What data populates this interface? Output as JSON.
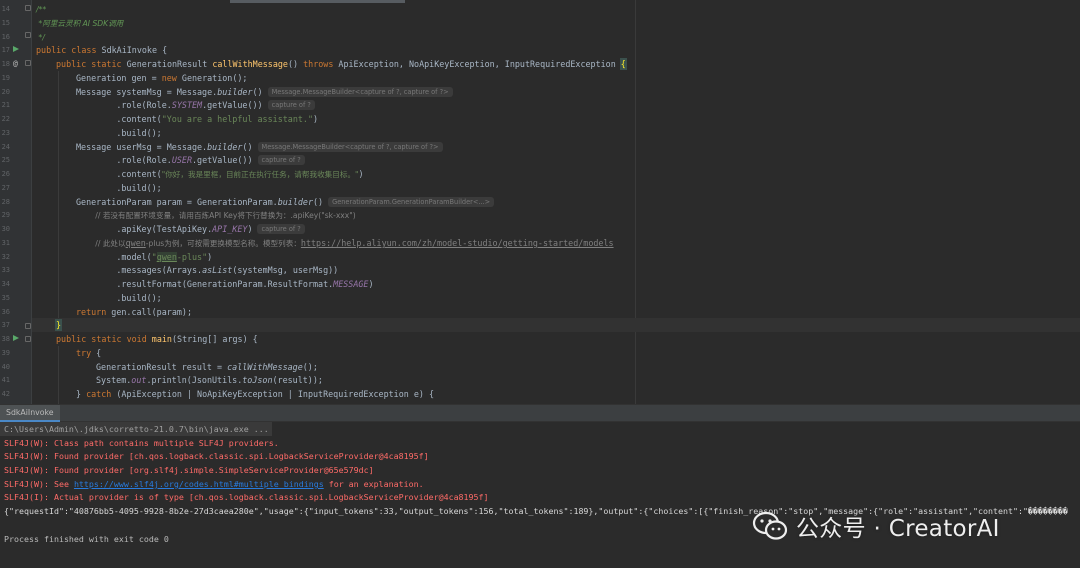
{
  "gutter": {
    "line_numbers": [
      "14",
      "15",
      "16",
      "17",
      "18",
      "19",
      "20",
      "21",
      "22",
      "23",
      "24",
      "25",
      "26",
      "27",
      "28",
      "29",
      "30",
      "31",
      "32",
      "33",
      "34",
      "35",
      "36",
      "37",
      "38",
      "39",
      "40",
      "41",
      "42"
    ],
    "annotation": "@"
  },
  "code": {
    "l14": "/**",
    "l15": " *阿里云灵积 AI SDK调用",
    "l16": " */",
    "l17_kw1": "public class",
    "l17_name": " SdkAiInvoke {",
    "l18_kw1": "public static",
    "l18_type": " GenerationResult ",
    "l18_fn": "callWithMessage",
    "l18_paren": "() ",
    "l18_kw2": "throws",
    "l18_rest": " ApiException, NoApiKeyException, InputRequiredException ",
    "l18_brace": "{",
    "l19_a": "Generation gen = ",
    "l19_kw": "new",
    "l19_b": " Generation();",
    "l20_a": "Message systemMsg = Message.",
    "l20_it": "builder",
    "l20_b": "()",
    "l20_hint": "Message.MessageBuilder<capture of ?, capture of ?>",
    "l21_a": "        .role(Role.",
    "l21_fi": "SYSTEM",
    "l21_b": ".getValue())",
    "l21_hint": "capture of ?",
    "l22_a": "        .content(",
    "l22_st": "\"You are a helpful assistant.\"",
    "l22_b": ")",
    "l23": "        .build();",
    "l24_a": "Message userMsg = Message.",
    "l24_it": "builder",
    "l24_b": "()",
    "l24_hint": "Message.MessageBuilder<capture of ?, capture of ?>",
    "l25_a": "        .role(Role.",
    "l25_fi": "USER",
    "l25_b": ".getValue())",
    "l25_hint": "capture of ?",
    "l26_a": "        .content(",
    "l26_st": "\"你好，我是里框，目前正在执行任务，请帮我收集目标。\"",
    "l26_b": ")",
    "l27": "        .build();",
    "l28_a": "GenerationParam param = GenerationParam.",
    "l28_it": "builder",
    "l28_b": "()",
    "l28_hint": "GenerationParam.GenerationParamBuilder<...>",
    "l29": "        // 若没有配置环境变量，请用百炼API Key将下行替换为：.apiKey(\"sk-xxx\")",
    "l30_a": "        .apiKey(TestApiKey.",
    "l30_fi": "API_KEY",
    "l30_b": ")",
    "l30_hint": "capture of ?",
    "l31_a": "        // 此处以",
    "l31_u1": "qwen",
    "l31_b": "-plus为例，可按需更换模型名称。模型列表：",
    "l31_u2": "https://help.aliyun.com/zh/model-studio/getting-started/models",
    "l32_a": "        .model(",
    "l32_st1": "\"",
    "l32_qw": "qwen",
    "l32_st2": "-plus\"",
    "l32_b": ")",
    "l33": "        .messages(Arrays.",
    "l33_it": "asList",
    "l33_b": "(systemMsg, userMsg))",
    "l34_a": "        .resultFormat(GenerationParam.ResultFormat.",
    "l34_fi": "MESSAGE",
    "l34_b": ")",
    "l35": "        .build();",
    "l36_kw": "return",
    "l36_b": " gen.call(param);",
    "l37": "}",
    "l38_kw": "public static void",
    "l38_fn": " main",
    "l38_b": "(String[] args) {",
    "l39_kw": "try",
    "l39_b": " {",
    "l40_a": "GenerationResult result = ",
    "l40_it": "callWithMessage",
    "l40_b": "();",
    "l41_a": "System.",
    "l41_fi": "out",
    "l41_b": ".println(JsonUtils.",
    "l41_it": "toJson",
    "l41_c": "(result));",
    "l42_a": "} ",
    "l42_kw": "catch",
    "l42_b": " (ApiException | NoApiKeyException | InputRequiredException e) {"
  },
  "run_panel": {
    "tab_label": "SdkAiInvoke"
  },
  "console": {
    "command": "C:\\Users\\Admin\\.jdks\\corretto-21.0.7\\bin\\java.exe ...",
    "err1": "SLF4J(W): Class path contains multiple SLF4J providers.",
    "err2": "SLF4J(W): Found provider [ch.qos.logback.classic.spi.LogbackServiceProvider@4ca8195f]",
    "err3": "SLF4J(W): Found provider [org.slf4j.simple.SimpleServiceProvider@65e579dc]",
    "err4_a": "SLF4J(W): See ",
    "err4_link": "https://www.slf4j.org/codes.html#multiple_bindings",
    "err4_b": " for an explanation.",
    "err5": "SLF4J(I): Actual provider is of type [ch.qos.logback.classic.spi.LogbackServiceProvider@4ca8195f]",
    "json_output": "{\"requestId\":\"40876bb5-4095-9928-8b2e-27d3caea280e\",\"usage\":{\"input_tokens\":33,\"output_tokens\":156,\"total_tokens\":189},\"output\":{\"choices\":[{\"finish_reason\":\"stop\",\"message\":{\"role\":\"assistant\",\"content\":\"��������",
    "exit_message": "Process finished with exit code 0"
  },
  "watermark": {
    "text": "公众号 · CreatorAI"
  },
  "colors": {
    "background": "#2b2b2b",
    "keyword": "#cc7832",
    "method": "#ffc66d",
    "string": "#6a8759",
    "field": "#9876aa",
    "error": "#ff6b68",
    "link": "#287bde"
  }
}
